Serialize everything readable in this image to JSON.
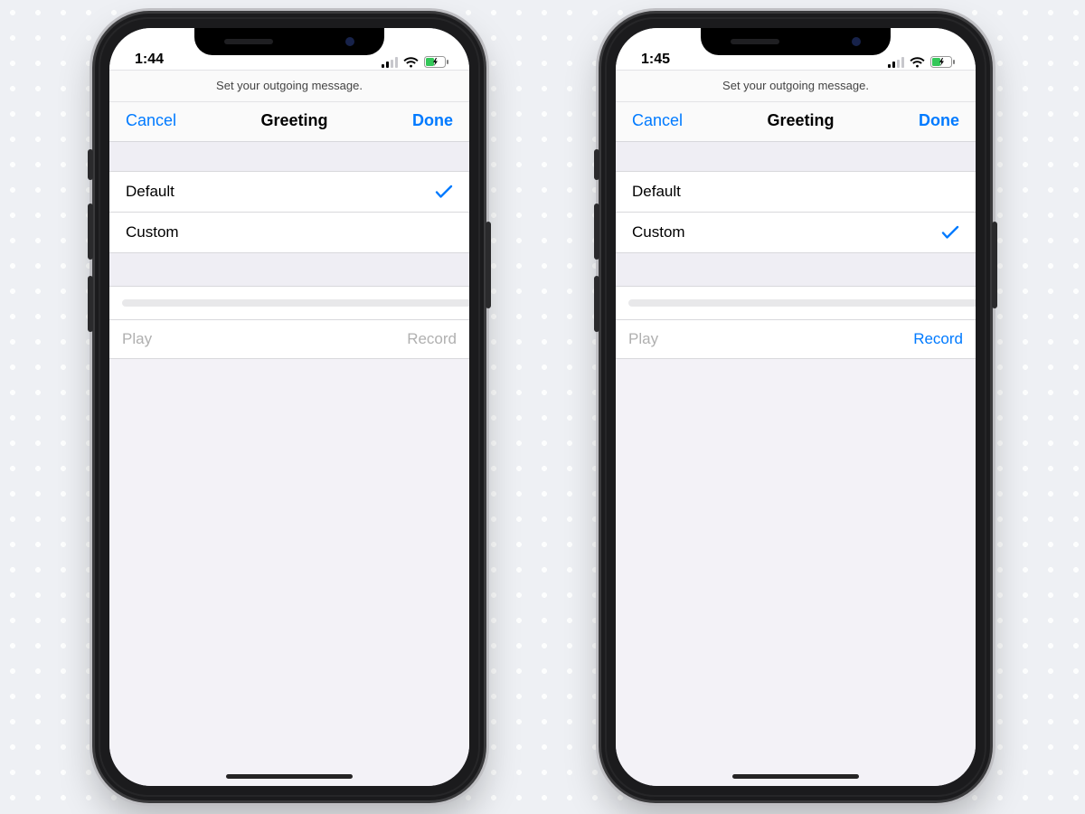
{
  "phones": [
    {
      "status_time": "1:44",
      "prompt": "Set your outgoing message.",
      "nav": {
        "cancel": "Cancel",
        "title": "Greeting",
        "done": "Done"
      },
      "options": [
        {
          "label": "Default",
          "selected": true
        },
        {
          "label": "Custom",
          "selected": false
        }
      ],
      "controls": {
        "play": "Play",
        "record": "Record"
      },
      "play_enabled": false,
      "record_enabled": false
    },
    {
      "status_time": "1:45",
      "prompt": "Set your outgoing message.",
      "nav": {
        "cancel": "Cancel",
        "title": "Greeting",
        "done": "Done"
      },
      "options": [
        {
          "label": "Default",
          "selected": false
        },
        {
          "label": "Custom",
          "selected": true
        }
      ],
      "controls": {
        "play": "Play",
        "record": "Record"
      },
      "play_enabled": false,
      "record_enabled": true
    }
  ],
  "colors": {
    "accent": "#007aff"
  }
}
